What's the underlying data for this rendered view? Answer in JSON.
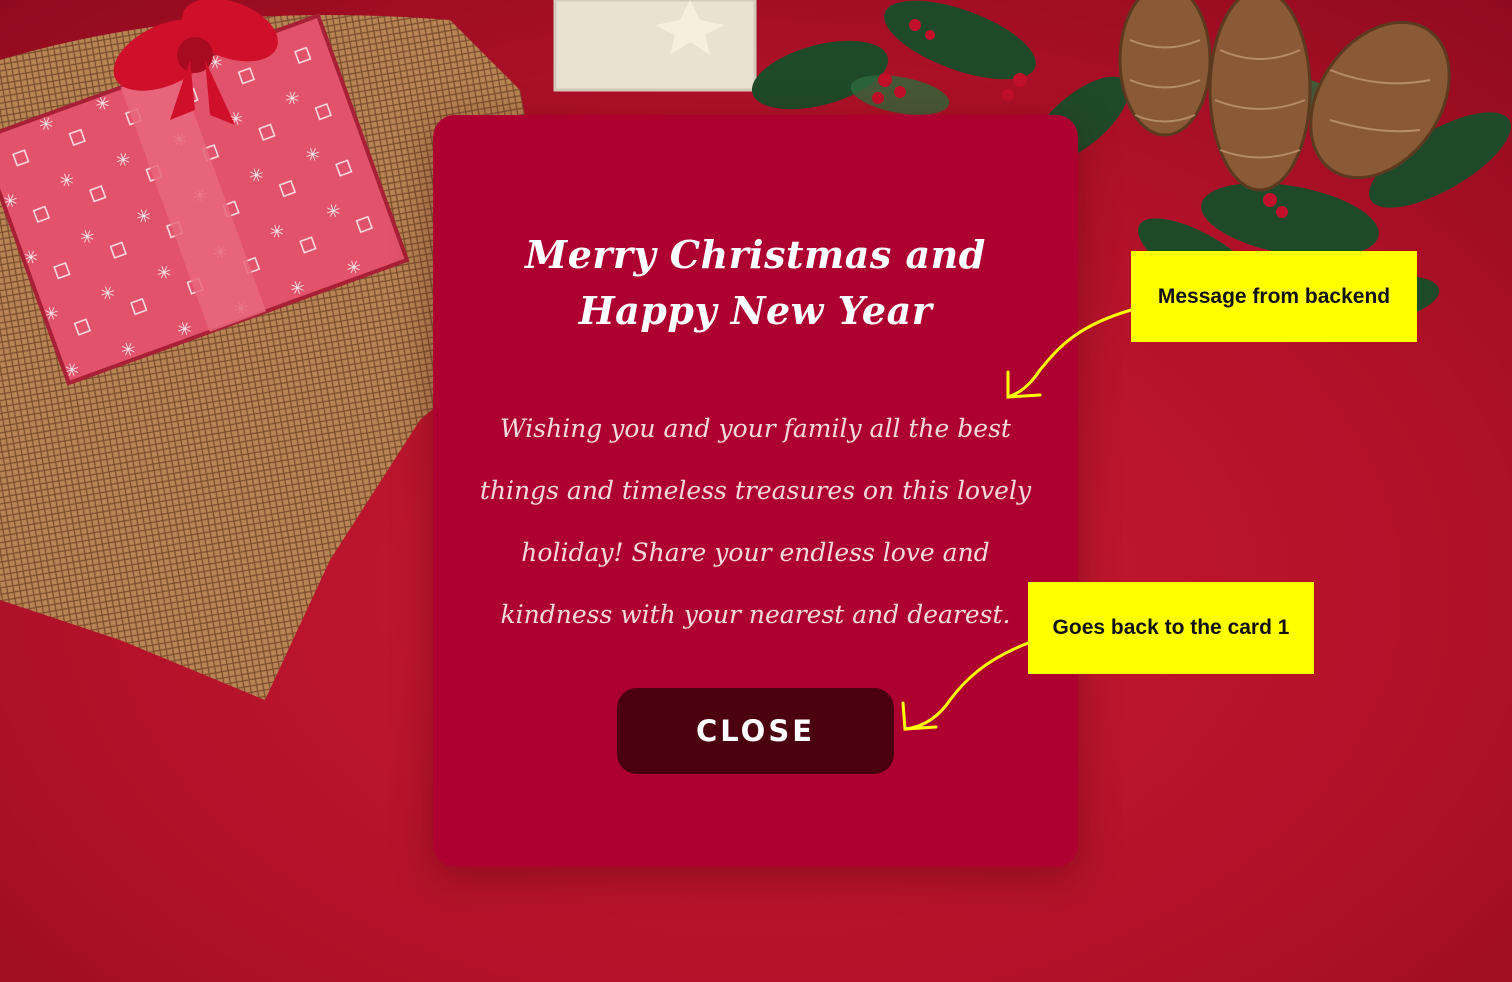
{
  "card": {
    "title": "Merry Christmas and Happy New Year",
    "message": "Wishing you and your family all the best things and timeless treasures on this lovely holiday! Share your endless love and kindness with your nearest and dearest.",
    "close_label": "CLOSE"
  },
  "annotations": [
    {
      "text": "Message from backend"
    },
    {
      "text": "Goes back to the card 1"
    }
  ],
  "colors": {
    "card": "#ad0030",
    "button": "#4a000f",
    "note": "#ffff00",
    "background": "#b3142c"
  }
}
